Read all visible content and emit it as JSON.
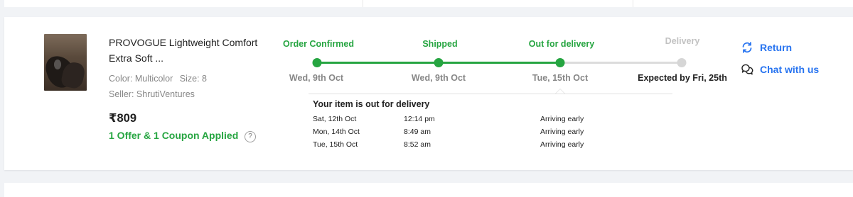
{
  "product": {
    "title_line1": "PROVOGUE Lightweight Comfort",
    "title_line2": "Extra Soft ...",
    "color": "Color: Multicolor",
    "size": "Size: 8",
    "seller": "Seller: ShrutiVentures",
    "price": "₹809",
    "offer": "1 Offer & 1 Coupon Applied",
    "help_glyph": "?"
  },
  "tracker": {
    "steps": [
      {
        "label": "Order Confirmed",
        "date": "Wed, 9th Oct",
        "status": "done"
      },
      {
        "label": "Shipped",
        "date": "Wed, 9th Oct",
        "status": "done"
      },
      {
        "label": "Out for delivery",
        "date": "Tue, 15th Oct",
        "status": "done"
      },
      {
        "label": "Delivery",
        "date": "Expected by Fri, 25th",
        "status": "pending"
      }
    ],
    "details_title": "Your item is out for delivery",
    "events": [
      {
        "date": "Sat, 12th Oct",
        "time": "12:14 pm",
        "status": "Arriving early"
      },
      {
        "date": "Mon, 14th Oct",
        "time": "8:49 am",
        "status": "Arriving early"
      },
      {
        "date": "Tue, 15th Oct",
        "time": "8:52 am",
        "status": "Arriving early"
      }
    ]
  },
  "actions": {
    "return_label": "Return",
    "return_icon": "refresh-icon",
    "chat_label": "Chat with us",
    "chat_icon": "chat-bubbles-icon"
  },
  "colors": {
    "accent_green": "#26a541",
    "link_blue": "#2874f0",
    "muted_gray": "#878787"
  }
}
